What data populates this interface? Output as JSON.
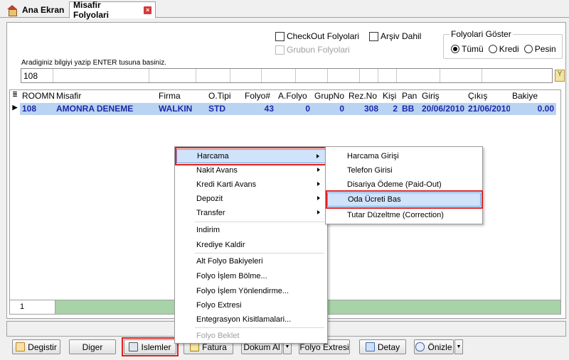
{
  "tabs": {
    "home": "Ana Ekran",
    "active": "Misafir Folyolari",
    "close": "×"
  },
  "filters": {
    "checkout": "CheckOut Folyolari",
    "archive": "Arşiv Dahil",
    "group": "Grubun Folyolari",
    "group_title": "Folyolari Göster",
    "radios": [
      "Tümü",
      "Kredi",
      "Pesin"
    ],
    "hint": "Aradiginiz bilgiyi yazip ENTER tusuna basiniz.",
    "search_value": "108",
    "search_btn": "Y"
  },
  "grid": {
    "headers": [
      "ROOMN",
      "Misafir",
      "Firma",
      "O.Tipi",
      "Folyo#",
      "A.Folyo",
      "GrupNo",
      "Rez.No",
      "Kişi",
      "Pan",
      "Giriş",
      "Çıkış",
      "Bakiye"
    ],
    "row": [
      "108",
      "AMONRA DENEME",
      "WALKIN",
      "STD",
      "43",
      "0",
      "0",
      "308",
      "2",
      "BB",
      "20/06/2010",
      "21/06/2010",
      "0.00"
    ],
    "row_marker": "▶",
    "header_marker": "≣",
    "footer_count": "1"
  },
  "menu": {
    "items": [
      "Harcama",
      "Nakit Avans",
      "Kredi Karti Avans",
      "Depozit",
      "Transfer",
      "Indirim",
      "Krediye Kaldir",
      "Alt Folyo Bakiyeleri",
      "Folyo İşlem Bölme...",
      "Folyo İşlem Yönlendirme...",
      "Folyo Extresi",
      "Entegrasyon Kisitlamalari...",
      "Folyo Beklet"
    ]
  },
  "submenu": {
    "items": [
      "Harcama Girişi",
      "Telefon Girisi",
      "Disariya Ödeme (Paid-Out)",
      "Oda Ücreti Bas",
      "Tutar Düzeltme (Correction)"
    ]
  },
  "toolbar": {
    "degistir": "Degistir",
    "diger": "Diger",
    "islemler": "Islemler",
    "fatura": "Fatura",
    "dokum": "Dokum Al",
    "extresi": "Folyo Extresi",
    "detay": "Detay",
    "onizle": "Önizle"
  }
}
